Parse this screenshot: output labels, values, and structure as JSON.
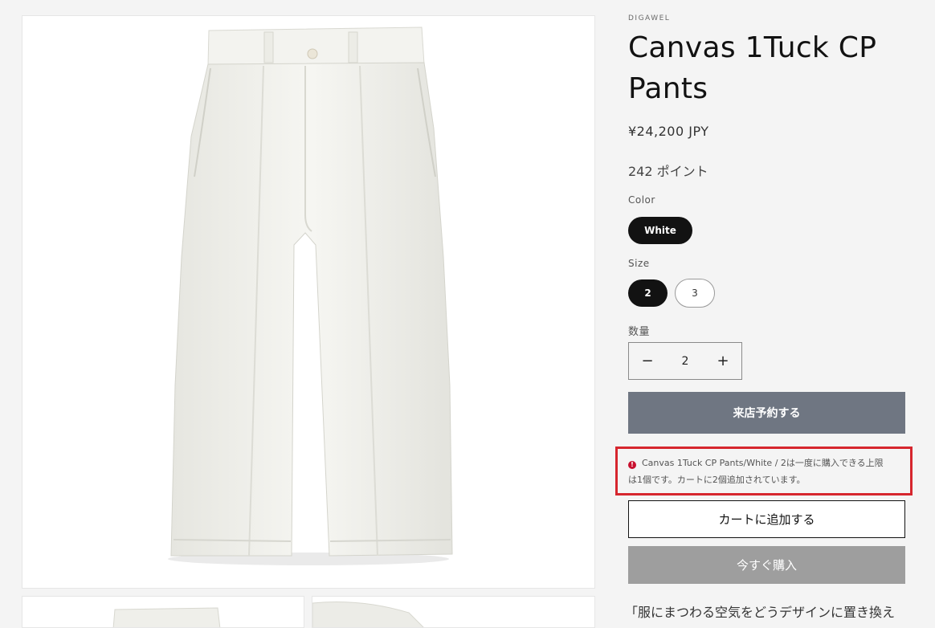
{
  "product": {
    "brand": "DIGAWEL",
    "title_line1": "Canvas 1Tuck CP",
    "title_line2": "Pants",
    "price": "¥24,200 JPY",
    "points": "242 ポイント"
  },
  "options": {
    "color_label": "Color",
    "color_selected": "White",
    "size_label": "Size",
    "sizes": [
      "2",
      "3"
    ],
    "size_selected": "2"
  },
  "quantity": {
    "label": "数量",
    "value": "2",
    "minus": "−",
    "plus": "+"
  },
  "buttons": {
    "reserve": "来店予約する",
    "add_to_cart": "カートに追加する",
    "buy_now": "今すぐ購入"
  },
  "error": {
    "icon": "!",
    "line1": "Canvas 1Tuck CP Pants/White / 2は一度に購入できる上限",
    "line2": "は1個です。カートに2個追加されています。"
  },
  "description_start": "「服にまつわる空気をどうデザインに置き換え",
  "colors": {
    "error_border": "#d6262e",
    "reserve_button": "#6f7682",
    "buy_button": "#9e9e9e",
    "active_pill": "#121212"
  }
}
